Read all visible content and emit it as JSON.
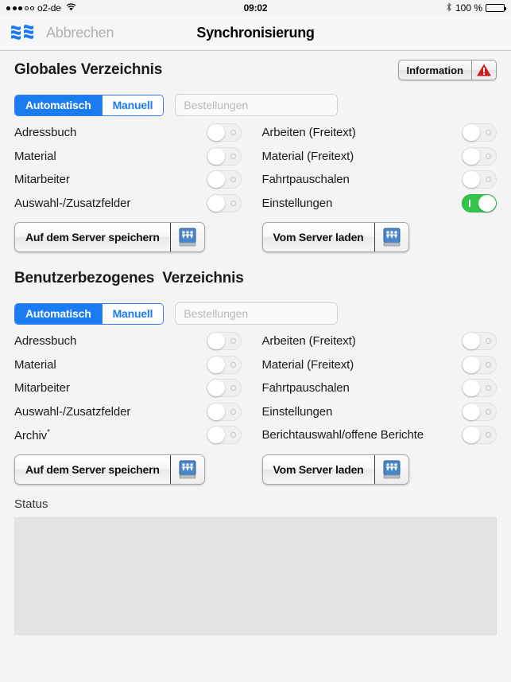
{
  "statusbar": {
    "carrier": "o2-de",
    "signal_filled": 3,
    "signal_hollow": 2,
    "wifi_icon": "wifi-icon",
    "time": "09:02",
    "bluetooth_icon": "bluetooth-icon",
    "battery_text": "100 %",
    "battery_level": 100
  },
  "navbar": {
    "logo_icon": "app-logo-icon",
    "cancel_label": "Abbrechen",
    "title": "Synchronisierung"
  },
  "colors": {
    "accent_blue": "#1a7cf0",
    "switch_on_green": "#35c44a",
    "warning_red": "#cc1f1f",
    "page_bg": "#f4f4f4",
    "status_box": "#e4e4e4"
  },
  "sections": [
    {
      "title": "Globales Verzeichnis",
      "info_button": {
        "label": "Information",
        "icon": "warning-triangle-icon"
      },
      "segmented": {
        "options": [
          "Automatisch",
          "Manuell"
        ],
        "selected": "Automatisch"
      },
      "text_field": {
        "value": "",
        "placeholder": "Bestellungen"
      },
      "left_switches": [
        {
          "label": "Adressbuch",
          "state": "off"
        },
        {
          "label": "Material",
          "state": "off"
        },
        {
          "label": "Mitarbeiter",
          "state": "off"
        },
        {
          "label": "Auswahl-/Zusatzfelder",
          "state": "off"
        }
      ],
      "right_switches": [
        {
          "label": "Arbeiten (Freitext)",
          "state": "off"
        },
        {
          "label": "Material (Freitext)",
          "state": "off"
        },
        {
          "label": "Fahrtpauschalen",
          "state": "off"
        },
        {
          "label": "Einstellungen",
          "state": "on"
        }
      ],
      "save_button": {
        "label": "Auf dem Server speichern",
        "icon": "network-drive-icon"
      },
      "load_button": {
        "label": "Vom Server laden",
        "icon": "network-drive-icon"
      }
    },
    {
      "title": "Benutzerbezogenes  Verzeichnis",
      "segmented": {
        "options": [
          "Automatisch",
          "Manuell"
        ],
        "selected": "Automatisch"
      },
      "text_field": {
        "value": "",
        "placeholder": "Bestellungen"
      },
      "left_switches": [
        {
          "label": "Adressbuch",
          "state": "off"
        },
        {
          "label": "Material",
          "state": "off"
        },
        {
          "label": "Mitarbeiter",
          "state": "off"
        },
        {
          "label": "Auswahl-/Zusatzfelder",
          "state": "off"
        },
        {
          "label": "Archiv",
          "superscript": "*",
          "state": "off"
        }
      ],
      "right_switches": [
        {
          "label": "Arbeiten (Freitext)",
          "state": "off"
        },
        {
          "label": "Material (Freitext)",
          "state": "off"
        },
        {
          "label": "Fahrtpauschalen",
          "state": "off"
        },
        {
          "label": "Einstellungen",
          "state": "off"
        },
        {
          "label": "Berichtauswahl/offene Berichte",
          "state": "off"
        }
      ],
      "save_button": {
        "label": "Auf dem Server speichern",
        "icon": "network-drive-icon"
      },
      "load_button": {
        "label": "Vom Server laden",
        "icon": "network-drive-icon"
      }
    }
  ],
  "status": {
    "label": "Status",
    "text": ""
  }
}
